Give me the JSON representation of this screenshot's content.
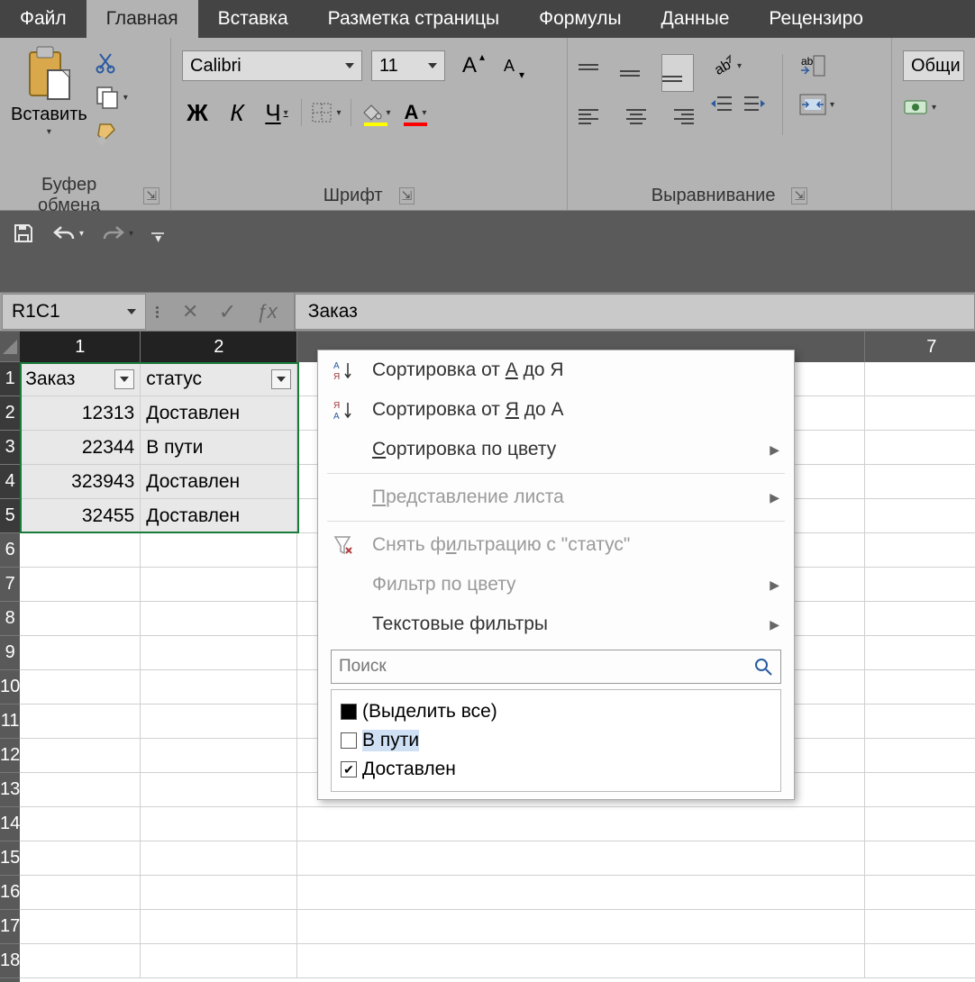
{
  "tabs": {
    "file": "Файл",
    "home": "Главная",
    "insert": "Вставка",
    "layout": "Разметка страницы",
    "formulas": "Формулы",
    "data": "Данные",
    "review": "Рецензиро"
  },
  "ribbon": {
    "clipboard": {
      "label": "Буфер обмена",
      "paste": "Вставить"
    },
    "font": {
      "label": "Шрифт",
      "name": "Calibri",
      "size": "11",
      "bold": "Ж",
      "italic": "К",
      "underline": "Ч"
    },
    "alignment": {
      "label": "Выравнивание"
    },
    "number": {
      "format": "Общи"
    }
  },
  "name_box": "R1C1",
  "formula_value": "Заказ",
  "columns": {
    "c1": "1",
    "c2": "2",
    "c7": "7"
  },
  "rows": [
    "1",
    "2",
    "3",
    "4",
    "5",
    "6",
    "7",
    "8",
    "9",
    "10",
    "11",
    "12",
    "13",
    "14",
    "15",
    "16",
    "17",
    "18"
  ],
  "table": {
    "headers": {
      "order": "Заказ",
      "status": "статус"
    },
    "rows": [
      {
        "order": "12313",
        "status": "Доставлен"
      },
      {
        "order": "22344",
        "status": "В пути"
      },
      {
        "order": "323943",
        "status": "Доставлен"
      },
      {
        "order": "32455",
        "status": "Доставлен"
      }
    ]
  },
  "filter_menu": {
    "sort_asc_pre": "Сортировка от ",
    "sort_asc_u": "А",
    "sort_asc_post": " до Я",
    "sort_desc_pre": "Сортировка от ",
    "sort_desc_u": "Я",
    "sort_desc_post": " до А",
    "sort_color_u": "С",
    "sort_color_post": "ортировка по цвету",
    "sheet_view_u": "П",
    "sheet_view_post": "редставление листа",
    "clear_filter_pre": "Снять ф",
    "clear_filter_u": "и",
    "clear_filter_post": "льтрацию с \"статус\"",
    "filter_color": "Фильтр по цвету",
    "text_filters": "Текстовые фильтры",
    "search_placeholder": "Поиск",
    "check_all": "(Выделить все)",
    "opt_transit": "В пути",
    "opt_delivered": "Доставлен"
  }
}
